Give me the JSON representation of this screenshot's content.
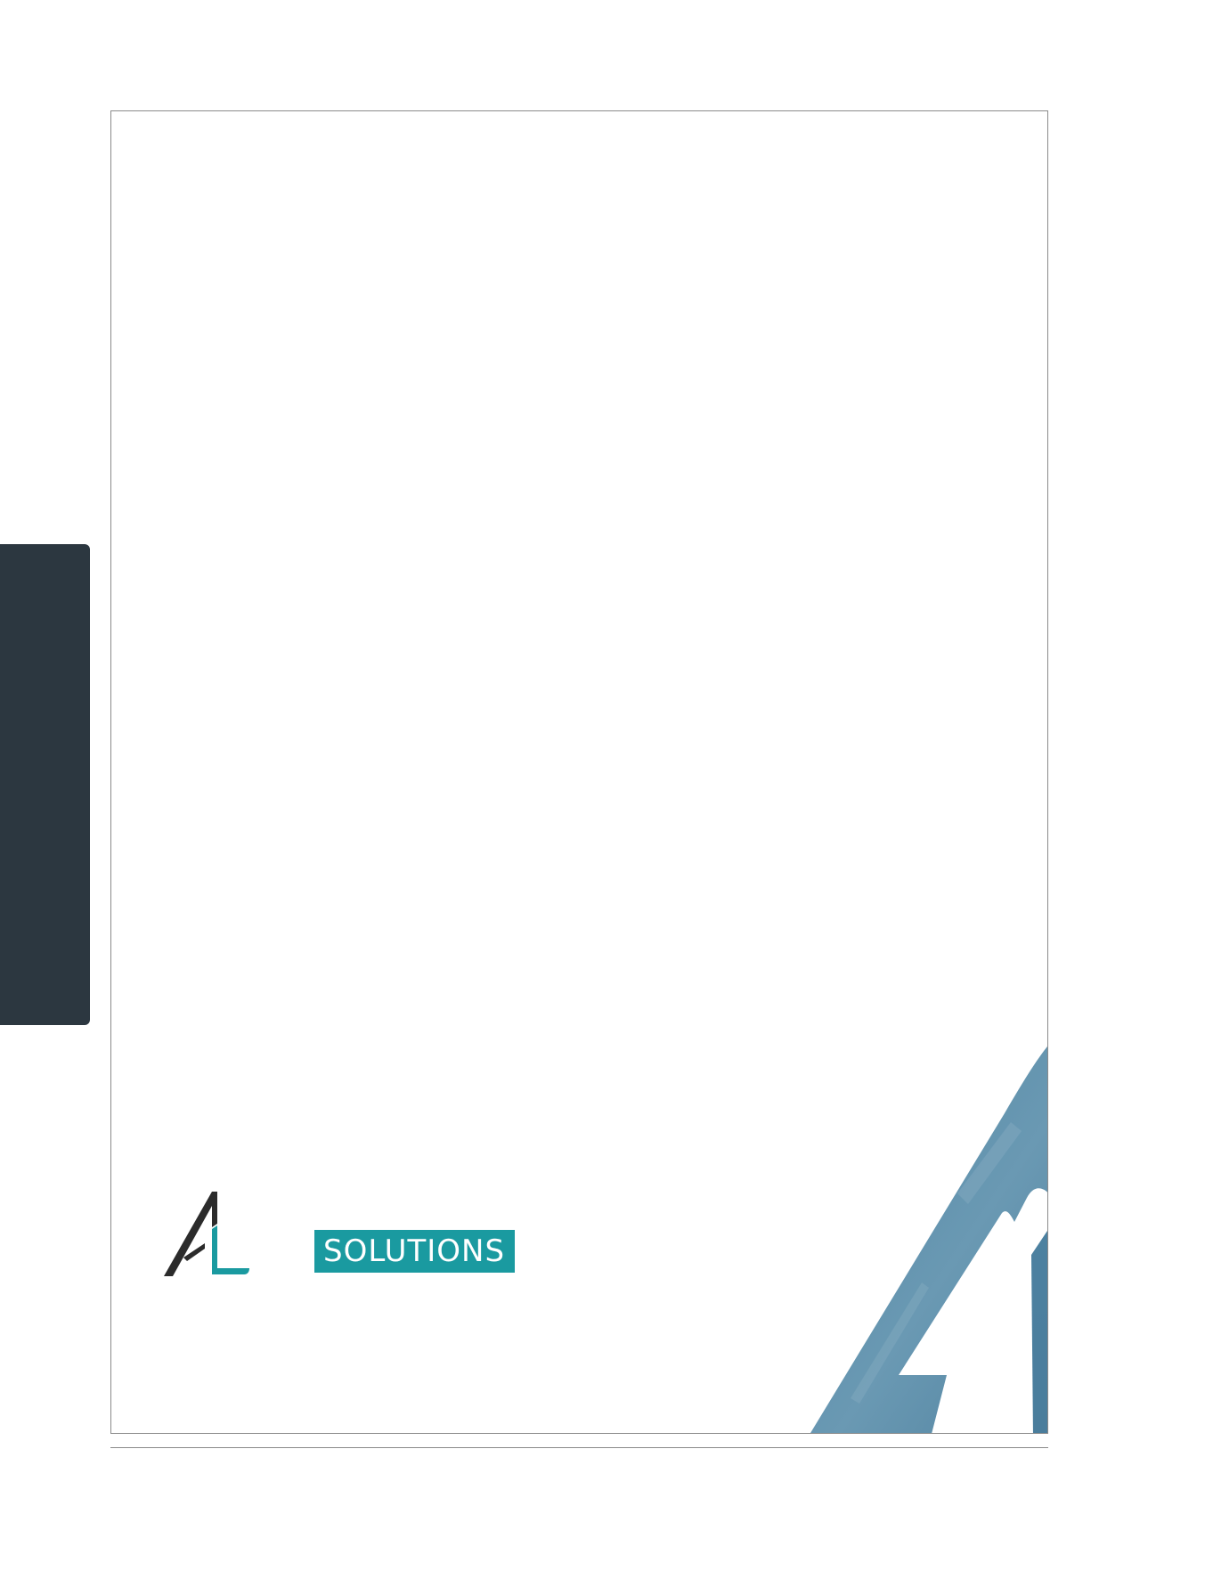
{
  "side_tab": {
    "color": "#2c3740"
  },
  "logo": {
    "dark_color": "#2b2b2b",
    "accent_color": "#1a9aa0"
  },
  "badge": {
    "label": "SOLUTIONS",
    "color": "#1a9aa0"
  },
  "cover_graphic": {
    "primary_color": "#5a8aa6",
    "secondary_color": "#7fa7bd"
  }
}
